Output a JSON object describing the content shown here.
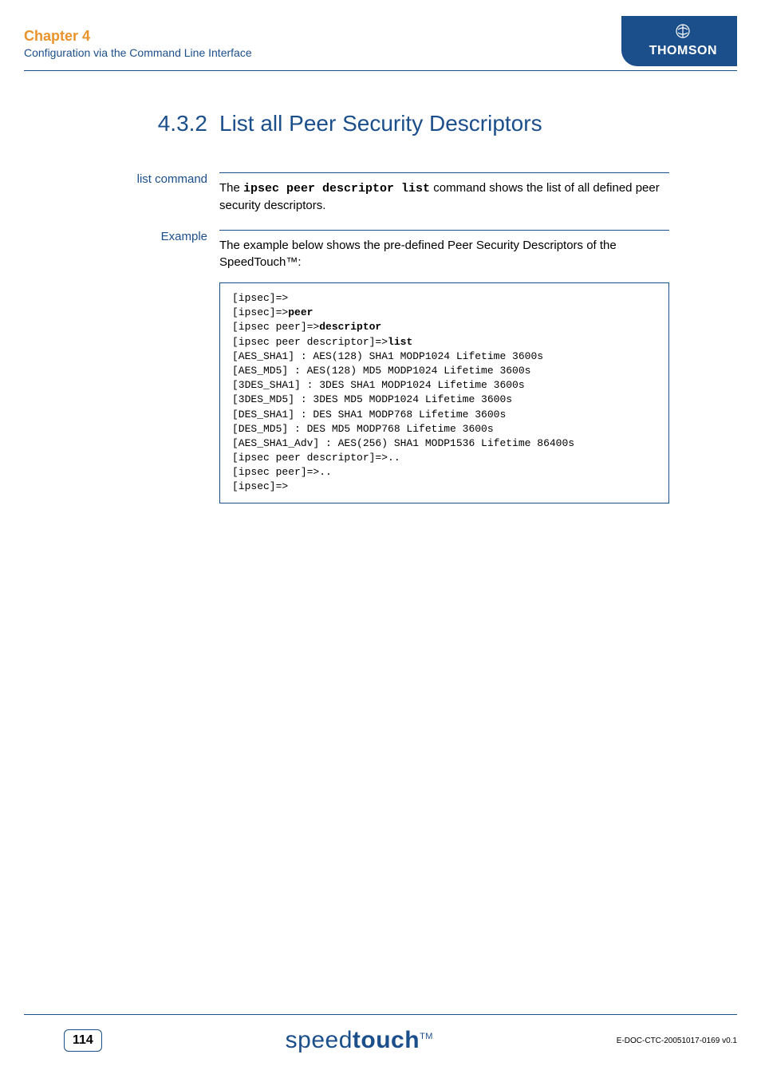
{
  "header": {
    "chapter_label": "Chapter 4",
    "chapter_subtitle": "Configuration via the Command Line Interface",
    "brand": "THOMSON"
  },
  "section": {
    "number": "4.3.2",
    "title": "List all Peer Security Descriptors"
  },
  "list_command": {
    "label": "list command",
    "text_prefix": "The ",
    "command": "ipsec peer descriptor list",
    "text_suffix": " command shows the list of all defined peer security descriptors."
  },
  "example": {
    "label": "Example",
    "intro": "The example below shows the pre-defined Peer Security Descriptors of the SpeedTouch™:",
    "code": {
      "line1": "[ipsec]=>",
      "line2_prefix": "[ipsec]=>",
      "line2_bold": "peer",
      "line3_prefix": "[ipsec peer]=>",
      "line3_bold": "descriptor",
      "line4_prefix": "[ipsec peer descriptor]=>",
      "line4_bold": "list",
      "line5": "[AES_SHA1] : AES(128) SHA1 MODP1024 Lifetime 3600s",
      "line6": "[AES_MD5] : AES(128) MD5 MODP1024 Lifetime 3600s",
      "line7": "[3DES_SHA1] : 3DES SHA1 MODP1024 Lifetime 3600s",
      "line8": "[3DES_MD5] : 3DES MD5 MODP1024 Lifetime 3600s",
      "line9": "[DES_SHA1] : DES SHA1 MODP768 Lifetime 3600s",
      "line10": "[DES_MD5] : DES MD5 MODP768 Lifetime 3600s",
      "line11": "[AES_SHA1_Adv] : AES(256) SHA1 MODP1536 Lifetime 86400s",
      "line12": "[ipsec peer descriptor]=>..",
      "line13": "[ipsec peer]=>..",
      "line14": "[ipsec]=>"
    }
  },
  "footer": {
    "page_number": "114",
    "logo_light": "speed",
    "logo_bold": "touch",
    "logo_tm": "TM",
    "doc_ref": "E-DOC-CTC-20051017-0169 v0.1"
  }
}
